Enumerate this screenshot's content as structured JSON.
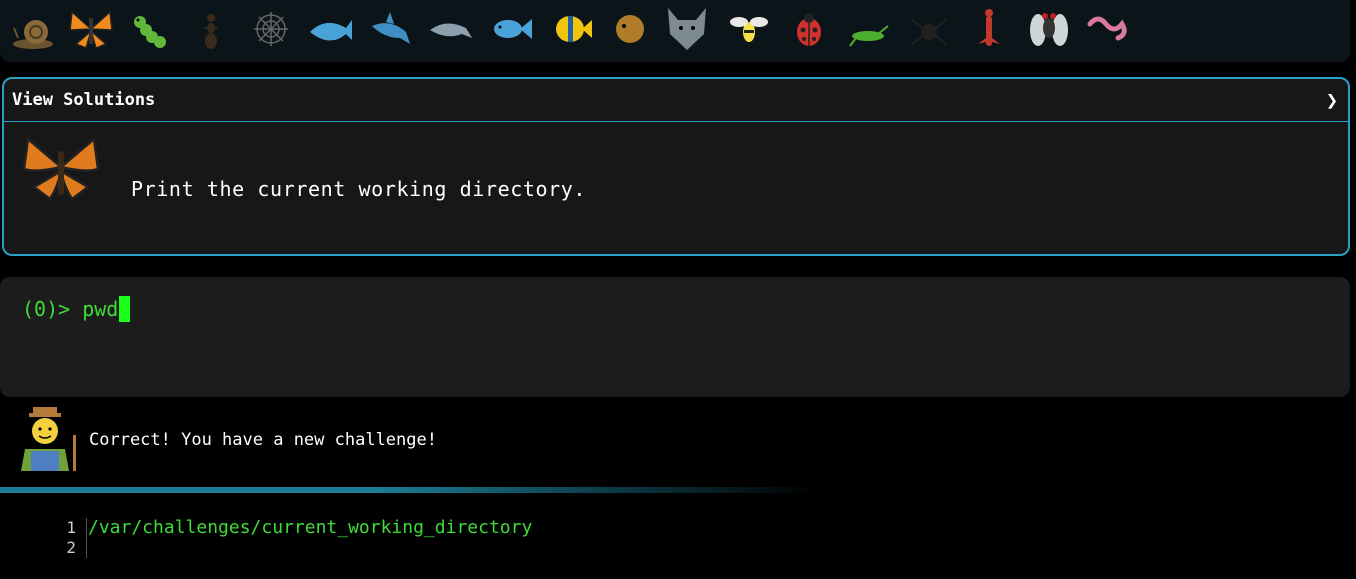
{
  "creatures": [
    {
      "name": "snail-icon",
      "color": "#8a6a3a"
    },
    {
      "name": "butterfly-icon",
      "color": "#f08a1c"
    },
    {
      "name": "caterpillar-icon",
      "color": "#5fb83a"
    },
    {
      "name": "ant-icon",
      "color": "#3a2a1a"
    },
    {
      "name": "spider-web-icon",
      "color": "#666666"
    },
    {
      "name": "whale-icon",
      "color": "#4aa3d8"
    },
    {
      "name": "shark-icon",
      "color": "#3f8fc4"
    },
    {
      "name": "dolphin-icon",
      "color": "#8aa0ad"
    },
    {
      "name": "fish-icon",
      "color": "#4aa3d8"
    },
    {
      "name": "tropical-fish-icon",
      "color": "#f1c40f"
    },
    {
      "name": "pufferfish-icon",
      "color": "#b07c2a"
    },
    {
      "name": "wolf-icon",
      "color": "#7d8a90"
    },
    {
      "name": "bee-icon",
      "color": "#f4e14a"
    },
    {
      "name": "ladybug-icon",
      "color": "#d0312d"
    },
    {
      "name": "cricket-icon",
      "color": "#4caf2c"
    },
    {
      "name": "spider-icon",
      "color": "#222222"
    },
    {
      "name": "scorpion-icon",
      "color": "#c0392b"
    },
    {
      "name": "fly-icon",
      "color": "#9aa4aa"
    },
    {
      "name": "worm-icon",
      "color": "#d87aa0"
    }
  ],
  "solutions": {
    "title": "View Solutions",
    "chevron": "❯",
    "icon": "butterfly-icon",
    "task": "Print the current working directory."
  },
  "terminal": {
    "prompt": "(0)>",
    "command": "pwd"
  },
  "feedback": {
    "avatar": "farmer-icon",
    "message": "Correct! You have a new challenge!"
  },
  "output": {
    "line_numbers": [
      "1",
      "2"
    ],
    "lines": [
      "/var/challenges/current_working_directory",
      ""
    ]
  },
  "colors": {
    "accent": "#2b9fc5",
    "prompt_green": "#3ddc37",
    "cursor_green": "#19ff19"
  }
}
